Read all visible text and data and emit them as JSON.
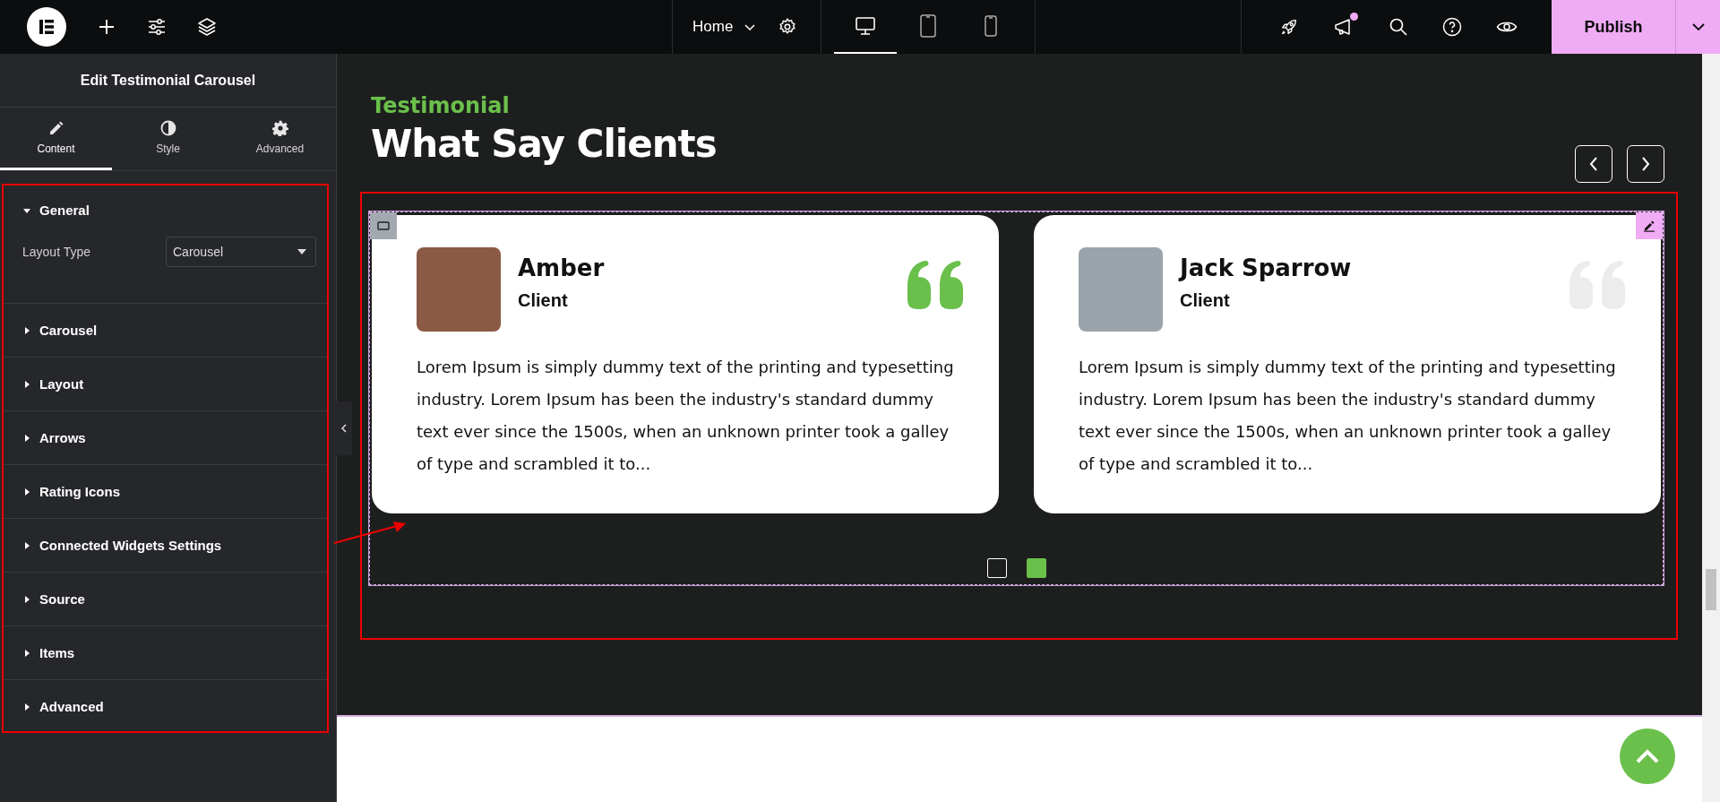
{
  "topbar": {
    "page_selector": "Home",
    "devices": [
      {
        "kind": "desktop",
        "selected": true
      },
      {
        "kind": "tablet",
        "selected": false
      },
      {
        "kind": "mobile",
        "selected": false
      }
    ],
    "publish_button": "Publish"
  },
  "panel": {
    "title": "Edit Testimonial Carousel",
    "tabs": [
      {
        "kind": "content",
        "label": "Content",
        "selected": true
      },
      {
        "kind": "style",
        "label": "Style",
        "selected": false
      },
      {
        "kind": "advanced",
        "label": "Advanced",
        "selected": false
      }
    ],
    "sections": [
      {
        "label": "General",
        "expanded": true,
        "fields": [
          {
            "label": "Layout Type",
            "value": "Carousel"
          }
        ]
      },
      {
        "label": "Carousel",
        "expanded": false
      },
      {
        "label": "Layout",
        "expanded": false
      },
      {
        "label": "Arrows",
        "expanded": false
      },
      {
        "label": "Rating Icons",
        "expanded": false
      },
      {
        "label": "Connected Widgets Settings",
        "expanded": false
      },
      {
        "label": "Source",
        "expanded": false
      },
      {
        "label": "Items",
        "expanded": false
      },
      {
        "label": "Advanced",
        "expanded": false
      }
    ]
  },
  "canvas": {
    "eyebrow": "Testimonial",
    "heading": "What Say Clients",
    "testimonials": [
      {
        "name": "Amber",
        "role": "Client",
        "text": "Lorem Ipsum is simply dummy text of the printing and typesetting industry. Lorem Ipsum has been the industry's standard dummy text ever since the 1500s, when an unknown printer took a galley of type and scrambled it to...",
        "active": true
      },
      {
        "name": "Jack Sparrow",
        "role": "Client",
        "text": "Lorem Ipsum is simply dummy text of the printing and typesetting industry. Lorem Ipsum has been the industry's standard dummy text ever since the 1500s, when an unknown printer took a galley of type and scrambled it to...",
        "active": false
      }
    ],
    "dots": [
      {
        "selected": false
      },
      {
        "selected": true
      }
    ]
  }
}
